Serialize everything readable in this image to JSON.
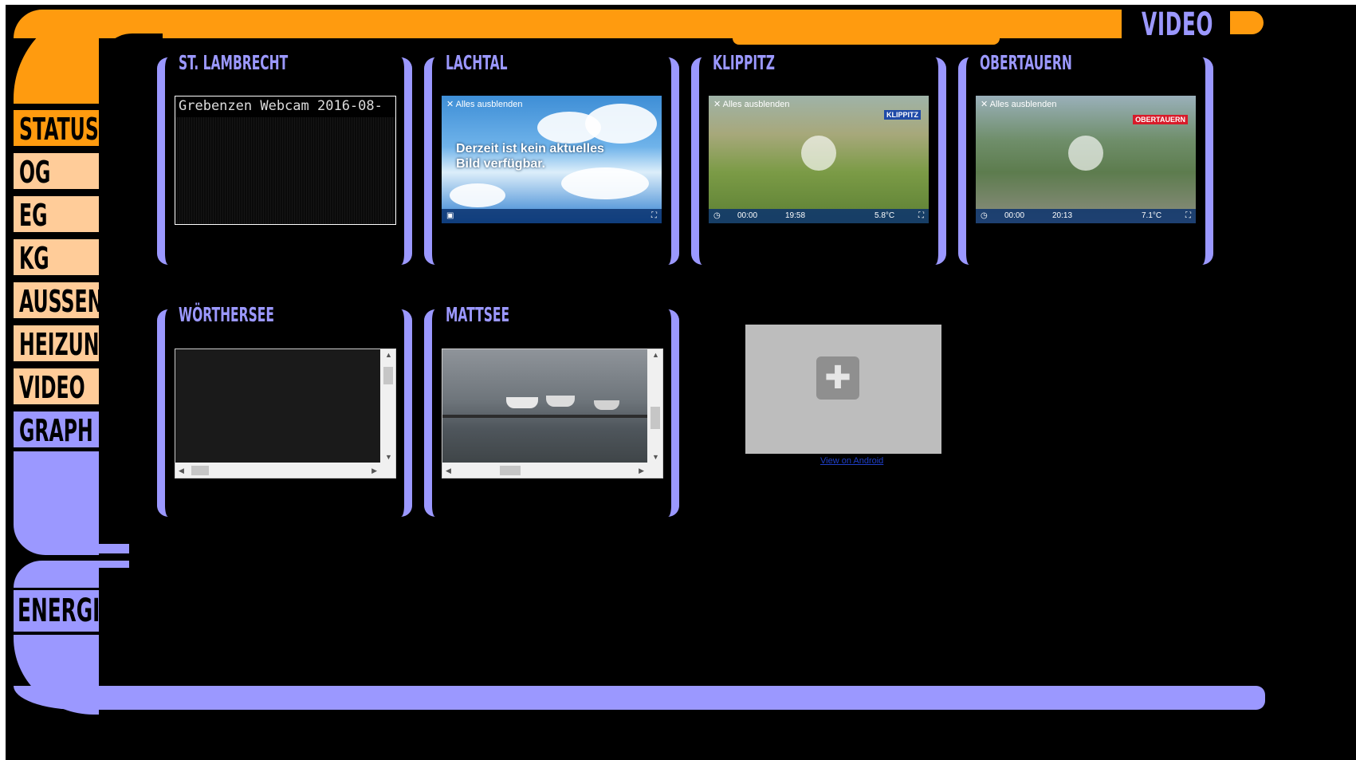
{
  "header": {
    "title": "VIDEO"
  },
  "nav": {
    "items": [
      "STATUS",
      "OG",
      "EG",
      "KG",
      "AUSSEN",
      "HEIZUNG",
      "VIDEO",
      "GRAPH"
    ],
    "energie": "ENERGIE"
  },
  "colors": {
    "orange": "#ff9b0f",
    "peach": "#ffcc99",
    "purple": "#9b98ff",
    "background": "#000000"
  },
  "cameras": [
    {
      "title": "ST. LAMBRECHT",
      "caption": "Grebenzen Webcam 2016-08-"
    },
    {
      "title": "LACHTAL",
      "overlay": "Alles ausblenden",
      "message": "Derzeit ist kein aktuelles Bild verfügbar."
    },
    {
      "title": "KLIPPITZ",
      "overlay": "Alles ausblenden",
      "time_left": "00:00",
      "clock": "19:58",
      "temp": "5.8°C",
      "brand": "KLIPPITZ"
    },
    {
      "title": "OBERTAUERN",
      "overlay": "Alles ausblenden",
      "time_left": "00:00",
      "clock": "20:13",
      "temp": "7.1°C",
      "brand": "OBERTAUERN"
    },
    {
      "title": "WÖRTHERSEE"
    },
    {
      "title": "MATTSEE"
    }
  ],
  "plugin": {
    "link": "View on Android",
    "icon": "puzzle-piece-icon"
  }
}
